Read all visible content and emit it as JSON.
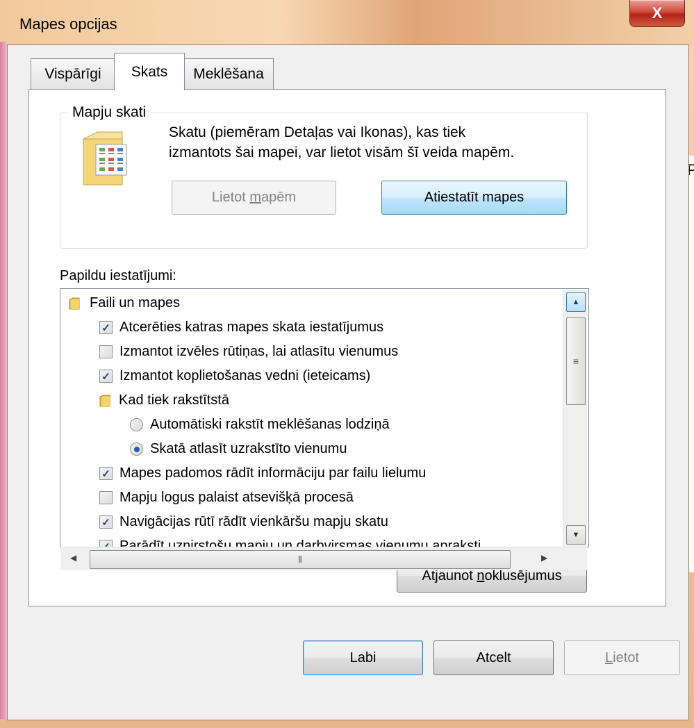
{
  "window": {
    "title": "Mapes opcijas",
    "close_glyph": "X"
  },
  "tabs": [
    {
      "label": "Vispārīgi",
      "active": false
    },
    {
      "label": "Skats",
      "active": true
    },
    {
      "label": "Meklēšana",
      "active": false
    }
  ],
  "folder_views": {
    "legend": "Mapju skati",
    "description_line1": "Skatu (piemēram Detaļas vai Ikonas), kas tiek",
    "description_line2": "izmantots šai mapei, var lietot visām šī veida mapēm.",
    "apply_button": {
      "pre": "Lietot ",
      "accel": "m",
      "post": "apēm",
      "disabled": true
    },
    "reset_button": {
      "label": "Atiestatīt mapes"
    }
  },
  "advanced": {
    "label": "Papildu iestatījumi:",
    "items": [
      {
        "kind": "folder",
        "label": "Faili un mapes",
        "indent": 0
      },
      {
        "kind": "checkbox",
        "label": "Atcerēties katras mapes skata iestatījumus",
        "checked": true,
        "indent": 1
      },
      {
        "kind": "checkbox",
        "label": "Izmantot izvēles rūtiņas, lai atlasītu vienumus",
        "checked": false,
        "indent": 1
      },
      {
        "kind": "checkbox",
        "label": "Izmantot koplietošanas vedni (ieteicams)",
        "checked": true,
        "indent": 1
      },
      {
        "kind": "folder",
        "label": "Kad tiek rakstītstā",
        "indent": 1
      },
      {
        "kind": "radio",
        "label": "Automātiski rakstīt meklēšanas lodziņā",
        "selected": false,
        "indent": 2
      },
      {
        "kind": "radio",
        "label": "Skatā atlasīt uzrakstīto vienumu",
        "selected": true,
        "indent": 2
      },
      {
        "kind": "checkbox",
        "label": "Mapes padomos rādīt informāciju par failu lielumu",
        "checked": true,
        "indent": 1
      },
      {
        "kind": "checkbox",
        "label": "Mapju logus palaist atsevišķā procesā",
        "checked": false,
        "indent": 1
      },
      {
        "kind": "checkbox",
        "label": "Navigācijas rūtī rādīt vienkāršu mapju skatu",
        "checked": true,
        "indent": 1
      },
      {
        "kind": "checkbox",
        "label": "Parādīt uznirstošu mapju un darbvirsmas vienumu apraksti",
        "checked": true,
        "indent": 1
      }
    ],
    "restore_button": {
      "pre": "Atjaunot ",
      "accel": "n",
      "post": "oklusējumus"
    }
  },
  "footer": {
    "ok_label": "Labi",
    "cancel_label": "Atcelt",
    "apply": {
      "accel": "L",
      "post": "ietot",
      "disabled": true
    }
  },
  "background_window": {
    "text_fragment": "P"
  },
  "colors": {
    "frame": "#f4c892",
    "focus_button": "#bee6fd",
    "check": "#2a3f7c",
    "radio_dot": "#1f5fa9"
  }
}
